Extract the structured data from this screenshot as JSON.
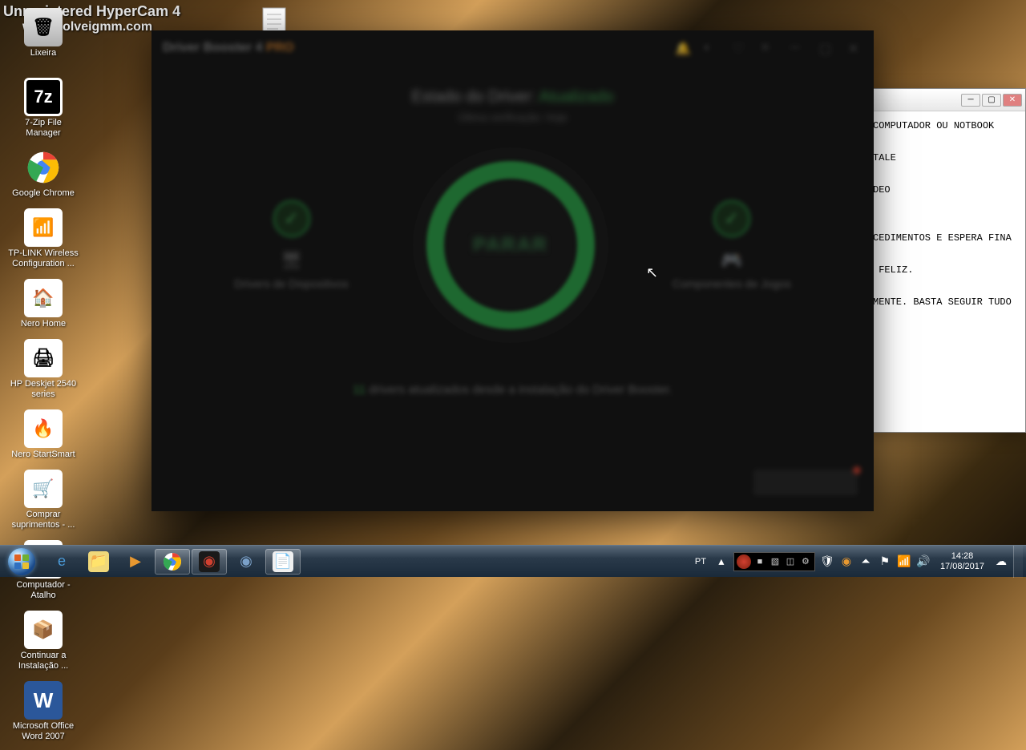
{
  "watermark": {
    "line1": "Unregistered HyperCam 4",
    "line2": "www.solveigmm.com"
  },
  "desktop_icons": [
    {
      "name": "lixeira",
      "label": "Lixeira",
      "bg": "linear-gradient(#e8e8e8,#b0b0b0)",
      "glyph": "🗑"
    },
    {
      "name": "blank",
      "label": "",
      "bg": "transparent",
      "glyph": ""
    },
    {
      "name": "7zip",
      "label": "7-Zip File Manager",
      "bg": "#fff",
      "glyph": "7z"
    },
    {
      "name": "chrome",
      "label": "Google Chrome",
      "bg": "transparent",
      "glyph": "◉"
    },
    {
      "name": "tplink",
      "label": "TP-LINK Wireless Configuration ...",
      "bg": "#fff",
      "glyph": "📶"
    },
    {
      "name": "nerohome",
      "label": "Nero Home",
      "bg": "#fff",
      "glyph": "🏠"
    },
    {
      "name": "hp",
      "label": "HP Deskjet 2540 series",
      "bg": "#fff",
      "glyph": "🖨"
    },
    {
      "name": "nerostart",
      "label": "Nero StartSmart",
      "bg": "#fff",
      "glyph": "🔥"
    },
    {
      "name": "comprar",
      "label": "Comprar suprimentos - ...",
      "bg": "#fff",
      "glyph": "🛒"
    },
    {
      "name": "computador",
      "label": "Computador - Atalho",
      "bg": "#fff",
      "glyph": "🖥"
    },
    {
      "name": "continuar",
      "label": "Continuar a Instalação ...",
      "bg": "#fff",
      "glyph": "📦"
    },
    {
      "name": "word",
      "label": "Microsoft Office Word 2007",
      "bg": "#fff",
      "glyph": "W"
    }
  ],
  "notepad": {
    "lines": "COMPUTADOR OU NOTBOOK\n\nTALE\n\nDEO\n\n\nCEDIMENTOS E ESPERA FINA\n\n FELIZ.\n\nMENTE. BASTA SEGUIR TUDO"
  },
  "driver_booster": {
    "title": "Driver Booster 4",
    "pro": "PRO",
    "status_label": "Estado do Driver:",
    "status_value": "Atualizado",
    "status_subtitle": "Última verificação: Hoje",
    "ring_label": "PARAR",
    "left_caption": "Drivers de Dispositivos",
    "right_caption": "Componentes de Jogos",
    "foot_count": "11",
    "foot_text": " drivers atualizados desde a instalação do Driver Booster."
  },
  "taskbar": {
    "lang": "PT",
    "time": "14:28",
    "date": "17/08/2017"
  }
}
